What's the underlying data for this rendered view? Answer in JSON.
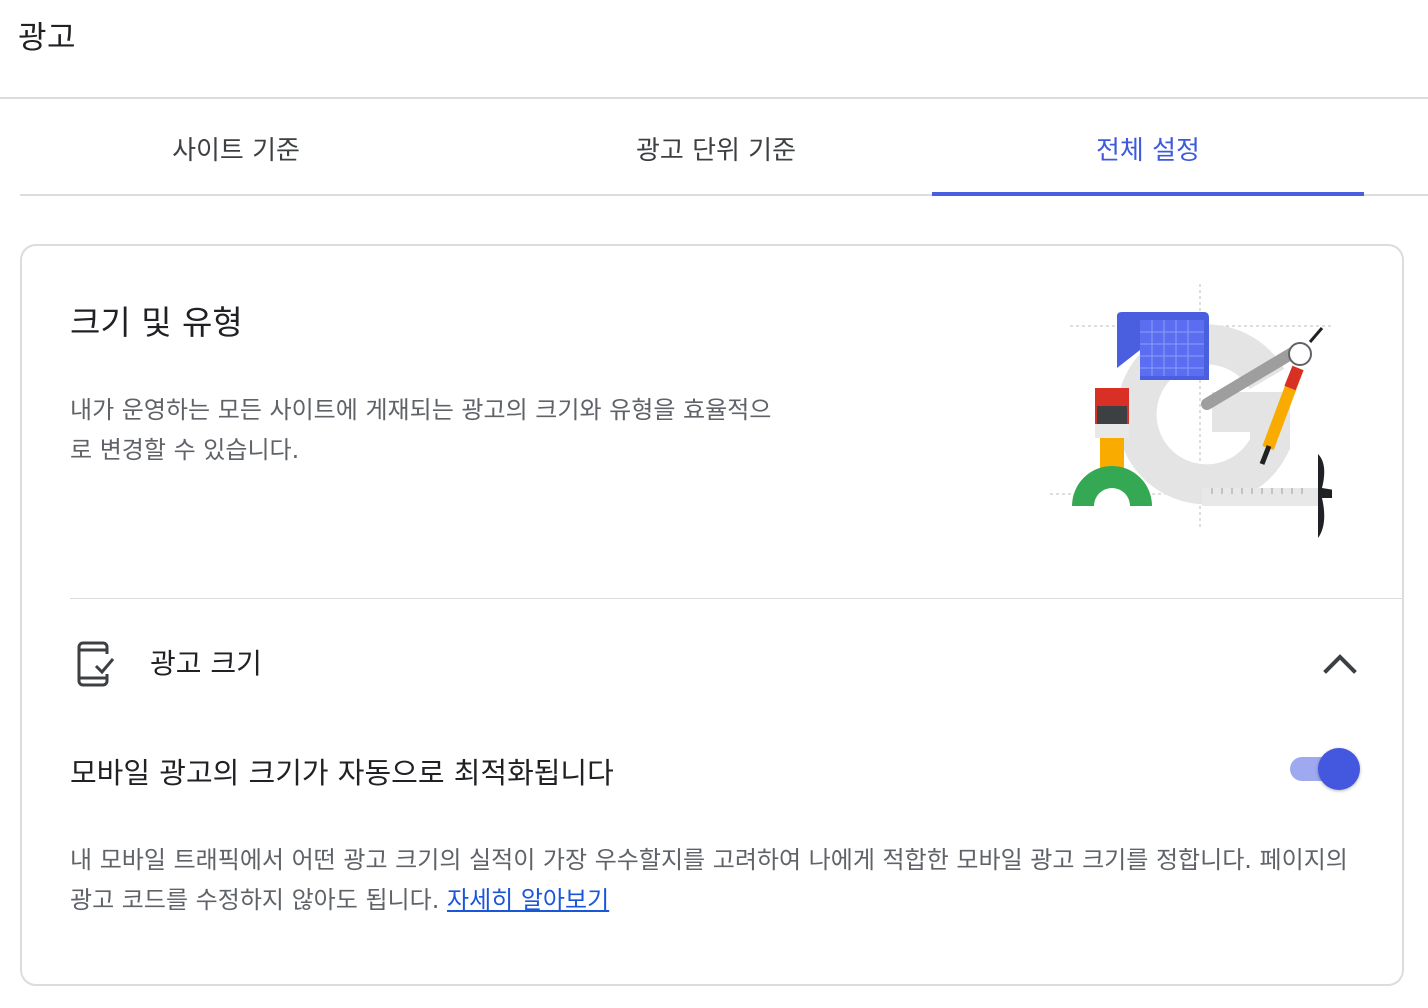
{
  "header": {
    "title": "광고"
  },
  "tabs": [
    {
      "label": "사이트 기준"
    },
    {
      "label": "광고 단위 기준"
    },
    {
      "label": "전체 설정",
      "active": true
    }
  ],
  "card": {
    "title": "크기 및 유형",
    "description": "내가 운영하는 모든 사이트에 게재되는 광고의 크기와 유형을 효율적으로 변경할 수 있습니다.",
    "ad_size": {
      "title": "광고 크기",
      "expanded": true,
      "setting_label": "모바일 광고의 크기가 자동으로 최적화됩니다",
      "toggle_on": true,
      "setting_description": "내 모바일 트래픽에서 어떤 광고 크기의 실적이 가장 우수할지를 고려하여 나에게 적합한 모바일 광고 크기를 정합니다. 페이지의 광고 코드를 수정하지 않아도 됩니다.",
      "learn_more": "자세히 알아보기"
    }
  },
  "colors": {
    "accent": "#4457df",
    "link": "#1a56d8",
    "divider": "#dadce0"
  }
}
